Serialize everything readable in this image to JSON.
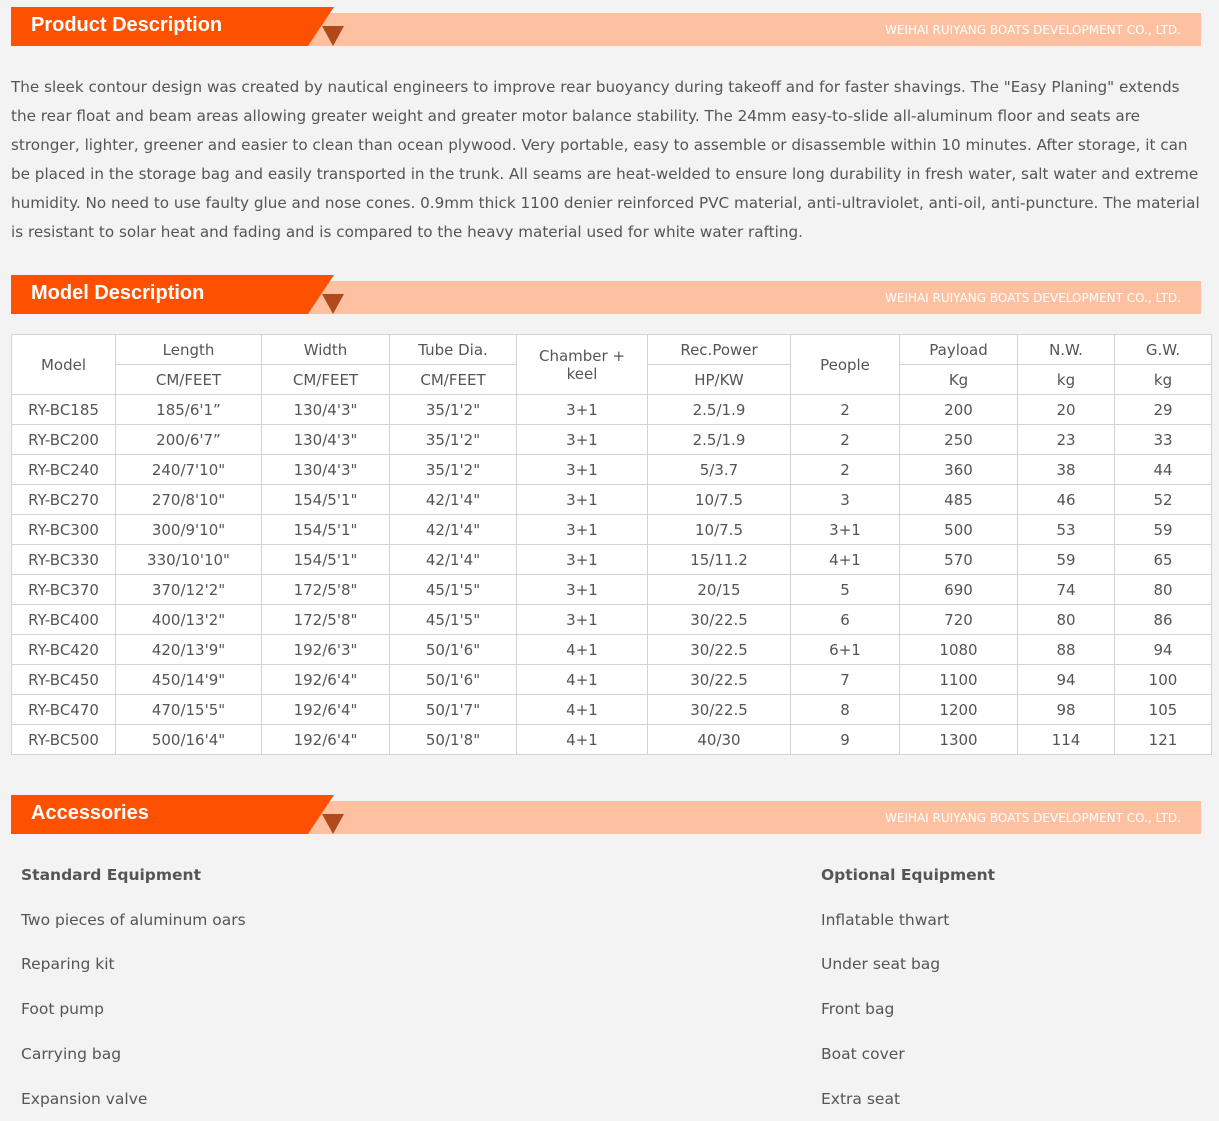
{
  "company": "WEIHAI RUIYANG BOATS DEVELOPMENT CO., LTD.",
  "colors": {
    "accent": "#fd5000",
    "bar": "#fdc1a1",
    "background": "#f3f3f3"
  },
  "sections": {
    "product": {
      "title": "Product Description"
    },
    "model": {
      "title": "Model Description"
    },
    "accessories": {
      "title": "Accessories"
    }
  },
  "product_description": "The sleek contour design was created by nautical engineers to improve rear buoyancy during takeoff and for faster shavings.  The \"Easy Planing\" extends the rear float and beam areas allowing greater weight and greater motor balance stability.  The 24mm easy-to-slide all-aluminum floor and seats are stronger, lighter, greener and easier to clean than ocean plywood.  Very portable, easy to assemble or disassemble within 10 minutes.  After storage, it can be placed in the storage bag and easily transported in the trunk.  All seams are heat-welded to ensure long durability in fresh water, salt water and extreme humidity.  No need to use faulty glue and nose cones.  0.9mm thick 1100 denier reinforced PVC material, anti-ultraviolet, anti-oil, anti-puncture.  The material is resistant to solar heat and fading and is compared to the heavy material used for white water rafting.",
  "table": {
    "headers": {
      "model": "Model",
      "length": "Length",
      "width": "Width",
      "tube": "Tube Dia.",
      "chamber": "Chamber + keel",
      "power": "Rec.Power",
      "people": "People",
      "payload": "Payload",
      "nw": "N.W.",
      "gw": "G.W."
    },
    "units": {
      "length": "CM/FEET",
      "width": "CM/FEET",
      "tube": "CM/FEET",
      "power": "HP/KW",
      "payload": "Kg",
      "nw": "kg",
      "gw": "kg"
    },
    "rows": [
      [
        "RY-BC185",
        "185/6'1”",
        "130/4'3\"",
        "35/1'2\"",
        "3+1",
        "2.5/1.9",
        "2",
        "200",
        "20",
        "29"
      ],
      [
        "RY-BC200",
        "200/6'7”",
        "130/4'3\"",
        "35/1'2\"",
        "3+1",
        "2.5/1.9",
        "2",
        "250",
        "23",
        "33"
      ],
      [
        "RY-BC240",
        "240/7'10\"",
        "130/4'3\"",
        "35/1'2\"",
        "3+1",
        "5/3.7",
        "2",
        "360",
        "38",
        "44"
      ],
      [
        "RY-BC270",
        "270/8'10\"",
        "154/5'1\"",
        "42/1'4\"",
        "3+1",
        "10/7.5",
        "3",
        "485",
        "46",
        "52"
      ],
      [
        "RY-BC300",
        "300/9'10\"",
        "154/5'1\"",
        "42/1'4\"",
        "3+1",
        "10/7.5",
        "3+1",
        "500",
        "53",
        "59"
      ],
      [
        "RY-BC330",
        "330/10'10\"",
        "154/5'1\"",
        "42/1'4\"",
        "3+1",
        "15/11.2",
        "4+1",
        "570",
        "59",
        "65"
      ],
      [
        "RY-BC370",
        "370/12'2\"",
        "172/5'8\"",
        "45/1'5\"",
        "3+1",
        "20/15",
        "5",
        "690",
        "74",
        "80"
      ],
      [
        "RY-BC400",
        "400/13'2\"",
        "172/5'8\"",
        "45/1'5\"",
        "3+1",
        "30/22.5",
        "6",
        "720",
        "80",
        "86"
      ],
      [
        "RY-BC420",
        "420/13'9\"",
        "192/6'3\"",
        "50/1'6\"",
        "4+1",
        "30/22.5",
        "6+1",
        "1080",
        "88",
        "94"
      ],
      [
        "RY-BC450",
        "450/14'9\"",
        "192/6'4\"",
        "50/1'6\"",
        "4+1",
        "30/22.5",
        "7",
        "1100",
        "94",
        "100"
      ],
      [
        "RY-BC470",
        "470/15'5\"",
        "192/6'4\"",
        "50/1'7\"",
        "4+1",
        "30/22.5",
        "8",
        "1200",
        "98",
        "105"
      ],
      [
        "RY-BC500",
        "500/16'4\"",
        "192/6'4\"",
        "50/1'8\"",
        "4+1",
        "40/30",
        "9",
        "1300",
        "114",
        "121"
      ]
    ]
  },
  "accessories": {
    "standard": {
      "heading": "Standard Equipment",
      "items": [
        "Two pieces of aluminum oars",
        "Reparing kit",
        "Foot pump",
        "Carrying bag",
        "Expansion valve"
      ]
    },
    "optional": {
      "heading": "Optional Equipment",
      "items": [
        "Inflatable thwart",
        "Under seat bag",
        "Front bag",
        "Boat cover",
        "Extra seat"
      ]
    }
  }
}
